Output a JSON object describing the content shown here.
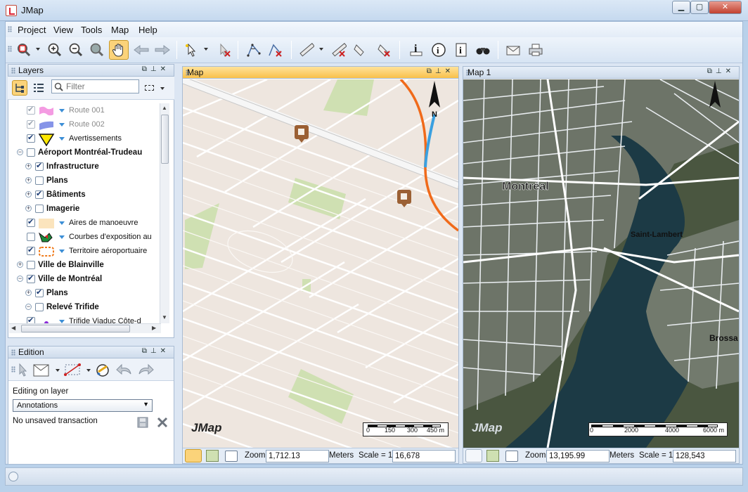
{
  "window": {
    "title": "JMap",
    "controls": {
      "minimize": "▁",
      "maximize": "▢",
      "close": "✕"
    }
  },
  "menu": [
    "Project",
    "View",
    "Tools",
    "Map",
    "Help"
  ],
  "toolbar": {
    "icons": [
      "zoom-select-icon",
      "zoom-in-icon",
      "zoom-out-icon",
      "zoom-extent-icon",
      "pan-hand-icon",
      "back-arrow-icon",
      "forward-arrow-icon",
      "select-pointer-icon",
      "deselect-icon",
      "measure-angle-icon",
      "clear-angle-icon",
      "measure-distance-icon",
      "clear-distance-icon",
      "measure-area-icon",
      "clear-area-icon",
      "info-icon",
      "info-circle-icon",
      "info-page-icon",
      "binoculars-icon",
      "email-icon",
      "print-icon"
    ]
  },
  "layers": {
    "title": "Layers",
    "filter_placeholder": "Filter",
    "items": [
      {
        "label": "Route 001",
        "level": 2,
        "checked": true,
        "dim": true,
        "symbol": "pink"
      },
      {
        "label": "Route 002",
        "level": 2,
        "checked": true,
        "dim": true,
        "symbol": "blue"
      },
      {
        "label": "Avertissements",
        "level": 2,
        "checked": true,
        "dim": false,
        "symbol": "yellow-triangle"
      },
      {
        "label": "Aéroport Montréal-Trudeau",
        "level": 0,
        "group": true,
        "checked": false,
        "expand": "−"
      },
      {
        "label": "Infrastructure",
        "level": 1,
        "group": true,
        "checked": true,
        "expand": "+"
      },
      {
        "label": "Plans",
        "level": 1,
        "group": true,
        "checked": false,
        "expand": "+"
      },
      {
        "label": "Bâtiments",
        "level": 1,
        "group": true,
        "checked": true,
        "expand": "+"
      },
      {
        "label": "Imagerie",
        "level": 1,
        "group": true,
        "checked": false,
        "expand": "+"
      },
      {
        "label": "Aires de manoeuvre",
        "level": 2,
        "checked": true,
        "symbol": "beige"
      },
      {
        "label": "Courbes d'exposition au",
        "level": 2,
        "checked": false,
        "symbol": "green-red"
      },
      {
        "label": "Territoire aéroportuaire",
        "level": 2,
        "checked": true,
        "symbol": "orange-dashed"
      },
      {
        "label": "Ville de Blainville",
        "level": 0,
        "group": true,
        "checked": false,
        "expand": "+"
      },
      {
        "label": "Ville de Montréal",
        "level": 0,
        "group": true,
        "checked": true,
        "expand": "−"
      },
      {
        "label": "Plans",
        "level": 1,
        "group": true,
        "checked": true,
        "expand": "+"
      },
      {
        "label": "Relevé Trifide",
        "level": 1,
        "group": true,
        "checked": false,
        "expand": "−"
      },
      {
        "label": "Trifide Viaduc Côte-d",
        "level": 2,
        "checked": true,
        "symbol": "purple-dot"
      }
    ]
  },
  "edition": {
    "title": "Edition",
    "editing_on_layer_label": "Editing on layer",
    "layer_selected": "Annotations",
    "transaction_status": "No unsaved transaction"
  },
  "maps": [
    {
      "title": "Map",
      "active": true,
      "zoom_label": "Zoom",
      "zoom_value": "1,712.13",
      "units": "Meters",
      "scale_label": "Scale = 1",
      "scale_value": "16,678",
      "scalebar_ticks": [
        "0",
        "150",
        "300",
        "450 m"
      ],
      "logo": "JMap",
      "north": "N"
    },
    {
      "title": "Map 1",
      "active": false,
      "zoom_label": "Zoom",
      "zoom_value": "13,195.99",
      "units": "Meters",
      "scale_label": "Scale = 1",
      "scale_value": "128,543",
      "scalebar_ticks": [
        "0",
        "2000",
        "4000",
        "6000 m"
      ],
      "logo": "JMap",
      "places": [
        "Montréal",
        "Saint-Lambert",
        "Brossa"
      ]
    }
  ]
}
